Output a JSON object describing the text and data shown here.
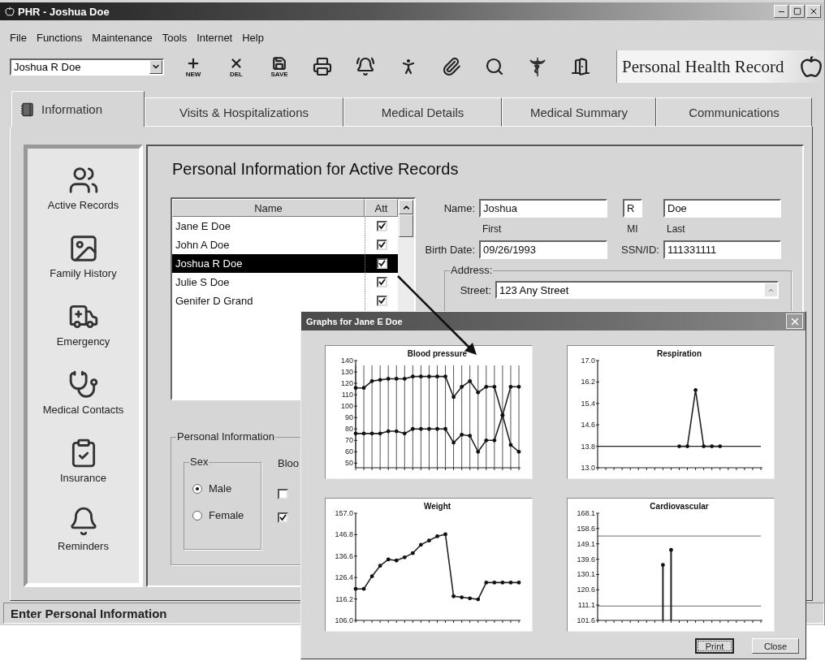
{
  "window": {
    "title": "PHR - Joshua Doe"
  },
  "menu": [
    "File",
    "Functions",
    "Maintenance",
    "Tools",
    "Internet",
    "Help"
  ],
  "toolbar": {
    "patient_select": {
      "value": "Joshua R Doe"
    },
    "buttons": [
      {
        "label": "NEW"
      },
      {
        "label": "DEL"
      },
      {
        "label": "SAVE"
      }
    ],
    "brand": "Personal Health Record"
  },
  "tabs": [
    {
      "label": "Information",
      "selected": true
    },
    {
      "label": "Visits & Hospitalizations",
      "selected": false
    },
    {
      "label": "Medical Details",
      "selected": false
    },
    {
      "label": "Medical Summary",
      "selected": false
    },
    {
      "label": "Communications",
      "selected": false
    }
  ],
  "sidebar": {
    "items": [
      "Active Records",
      "Family History",
      "Emergency",
      "Medical Contacts",
      "Insurance",
      "Reminders"
    ]
  },
  "content": {
    "heading": "Personal Information for Active Records",
    "records": {
      "columns": [
        "Name",
        "Att"
      ],
      "rows": [
        {
          "name": "Jane E Doe",
          "att": true,
          "selected": false
        },
        {
          "name": "John A Doe",
          "att": true,
          "selected": false
        },
        {
          "name": "Joshua R Doe",
          "att": true,
          "selected": true
        },
        {
          "name": "Julie S Doe",
          "att": true,
          "selected": false
        },
        {
          "name": "Genifer D Grand",
          "att": true,
          "selected": false
        }
      ]
    },
    "name": {
      "label": "Name:",
      "first": "Joshua",
      "mi": "R",
      "last": "Doe",
      "captions": [
        "First",
        "MI",
        "Last"
      ]
    },
    "birth_date": {
      "label": "Birth Date:",
      "value": "09/26/1993"
    },
    "ssn": {
      "label": "SSN/ID:",
      "value": "111331111"
    },
    "address": {
      "legend": "Address:",
      "street_label": "Street:",
      "street": "123 Any Street"
    },
    "personal_info": {
      "legend": "Personal Information",
      "sex": {
        "legend": "Sex",
        "options": [
          {
            "label": "Male",
            "selected": true
          },
          {
            "label": "Female",
            "selected": false
          }
        ]
      },
      "blood": {
        "legend": "Bloo",
        "options": [
          {
            "checked": false
          },
          {
            "checked": true
          }
        ]
      }
    }
  },
  "status_bar": {
    "text": "Enter Personal Information"
  },
  "graphs_dialog": {
    "title": "Graphs for Jane E Doe",
    "charts": [
      {
        "chart_data": {
          "type": "line",
          "title": "Blood pressure",
          "ylim": [
            46,
            140
          ],
          "yticks": [
            50,
            60,
            70,
            80,
            90,
            100,
            110,
            120,
            130,
            140
          ],
          "grid": true,
          "series": [
            {
              "values": [
                116,
                116,
                122,
                123,
                124,
                124,
                124,
                126,
                126,
                126,
                126,
                126,
                108,
                117,
                122,
                112,
                117,
                117,
                92,
                117,
                117
              ]
            },
            {
              "values": [
                76,
                76,
                76,
                76,
                78,
                78,
                76,
                80,
                80,
                80,
                80,
                80,
                68,
                75,
                74,
                60,
                70,
                70,
                92,
                66,
                60
              ]
            }
          ]
        }
      },
      {
        "chart_data": {
          "type": "line",
          "title": "Respiration",
          "ylim": [
            13,
            17
          ],
          "yticks": [
            {
              "value": 13,
              "label": "13.0"
            },
            {
              "value": 13.8,
              "label": "13.8"
            },
            {
              "value": 14.6,
              "label": "14.6"
            },
            {
              "value": 15.4,
              "label": "15.4"
            },
            {
              "value": 16.2,
              "label": "16.2"
            },
            {
              "value": 17,
              "label": "17.0"
            }
          ],
          "ref_lines": [
            {
              "axis": "y",
              "value": 13.8
            }
          ],
          "series": [
            {
              "values": [
                null,
                null,
                null,
                null,
                null,
                null,
                null,
                null,
                null,
                null,
                13.8,
                13.8,
                15.9,
                13.8,
                13.8,
                13.8,
                null,
                null,
                null,
                null,
                null
              ]
            }
          ]
        }
      },
      {
        "chart_data": {
          "type": "line",
          "title": "Weight",
          "ylim": [
            106,
            157
          ],
          "yticks": [
            {
              "value": 106,
              "label": "106.0"
            },
            {
              "value": 116.2,
              "label": "116.2"
            },
            {
              "value": 126.4,
              "label": "126.4"
            },
            {
              "value": 136.6,
              "label": "136.6"
            },
            {
              "value": 146.8,
              "label": "146.8"
            },
            {
              "value": 157,
              "label": "157.0"
            }
          ],
          "series": [
            {
              "values": [
                121,
                121,
                127,
                132,
                135,
                134.5,
                136,
                138,
                142,
                144,
                146,
                147,
                117.5,
                117,
                116.5,
                116,
                124,
                124,
                124,
                124,
                124
              ]
            }
          ]
        }
      },
      {
        "chart_data": {
          "type": "bar",
          "title": "Cardiovascular",
          "ylim": [
            101.6,
            168.1
          ],
          "yticks": [
            101.6,
            111.1,
            120.6,
            130.1,
            139.6,
            149.1,
            158.6,
            168.1
          ],
          "ref_lines": [
            {
              "axis": "y",
              "value": 153.9
            },
            {
              "axis": "y",
              "value": 110.5
            }
          ],
          "series": [
            {
              "values": [
                null,
                null,
                null,
                null,
                null,
                null,
                null,
                null,
                136,
                145.3,
                null,
                null,
                null,
                null,
                null,
                null,
                null,
                null,
                null,
                null,
                null
              ]
            }
          ]
        }
      }
    ],
    "buttons": [
      {
        "label": "Print",
        "focused": true
      },
      {
        "label": "Close",
        "focused": false
      }
    ]
  }
}
